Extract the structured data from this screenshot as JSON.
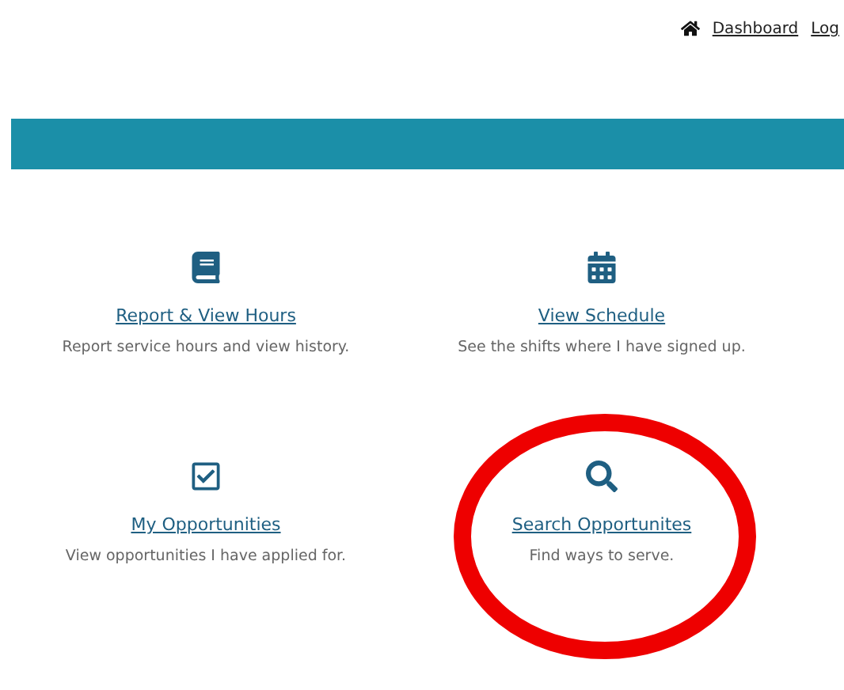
{
  "top_nav": [
    {
      "kind": "home",
      "label": "Dashboard"
    },
    {
      "kind": "plain",
      "label": "Log"
    }
  ],
  "cards": [
    {
      "kind": "book",
      "title": "Report & View Hours",
      "description": "Report service hours and view history.",
      "highlighted": false
    },
    {
      "kind": "calendar",
      "title": "View Schedule",
      "description": "See the shifts where I have signed up.",
      "highlighted": false
    },
    {
      "kind": "check",
      "title": "My Opportunities",
      "description": "View opportunities I have applied for.",
      "highlighted": false
    },
    {
      "kind": "search",
      "title": "Search Opportunites",
      "description": "Find ways to serve.",
      "highlighted": true
    }
  ]
}
